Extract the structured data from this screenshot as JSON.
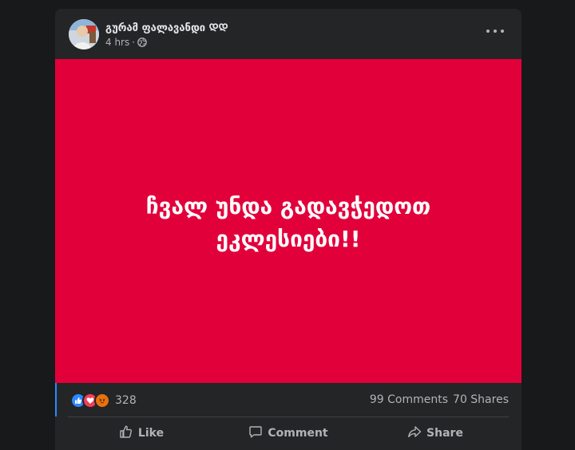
{
  "post": {
    "author": "გურამ ფალავანდი ᲓᲓ",
    "time": "4 hrs",
    "separator": "·",
    "privacy_icon": "globe-icon",
    "image_text": "ჩვალ უნდა გადავჭედოთ ეკლესიები!!",
    "image_bg": "#e2003b"
  },
  "reactions": {
    "icons": [
      "like-reaction-icon",
      "love-reaction-icon",
      "angry-reaction-icon"
    ],
    "count": "328"
  },
  "counts": {
    "comments": "99 Comments",
    "shares": "70 Shares"
  },
  "actions": {
    "like": "Like",
    "comment": "Comment",
    "share": "Share"
  },
  "colors": {
    "page_bg": "#18191a",
    "card_bg": "#242526",
    "accent": "#2d88ff",
    "secondary_text": "#b0b3b8"
  }
}
